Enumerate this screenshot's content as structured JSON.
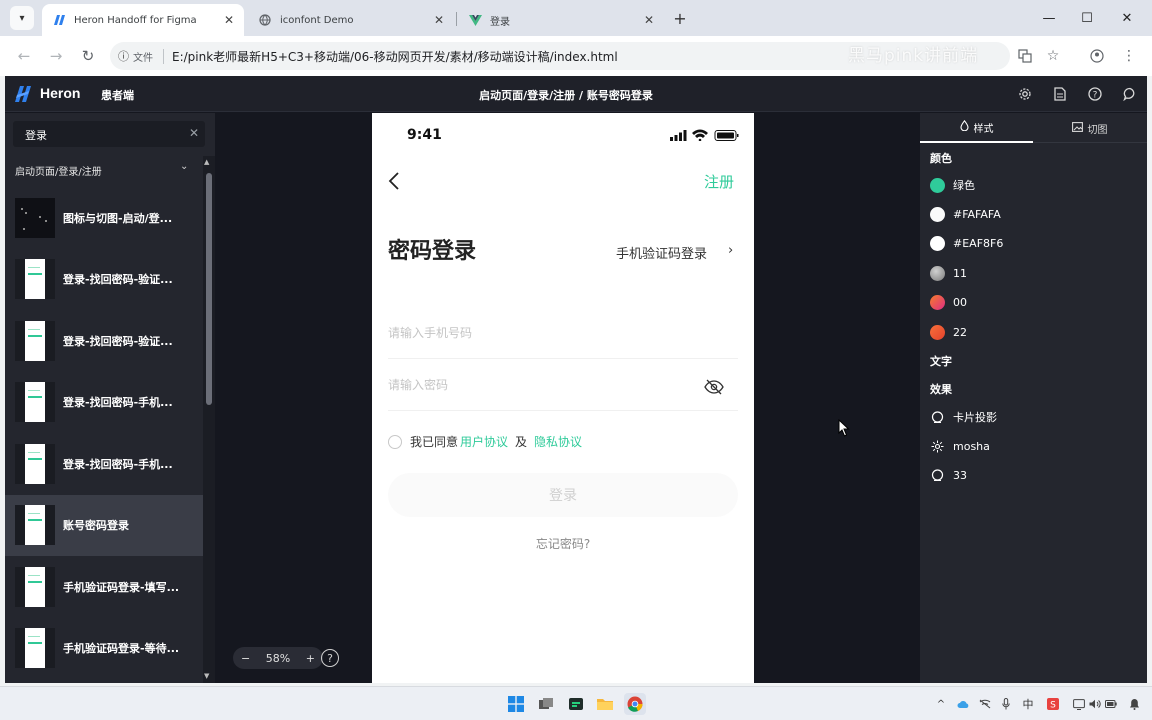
{
  "browser": {
    "tabs": [
      {
        "label": "Heron Handoff for Figma",
        "icon": "heron-tab-icon",
        "active": true
      },
      {
        "label": "iconfont Demo",
        "icon": "globe-icon",
        "active": false
      },
      {
        "label": "登录",
        "icon": "vue-logo-icon",
        "active": false
      }
    ],
    "address": {
      "scheme_label": "文件",
      "url": "E:/pink老师最新H5+C3+移动端/06-移动网页开发/素材/移动端设计稿/index.html"
    },
    "watermark": "黑马pink讲前端"
  },
  "header": {
    "logo": "Heron",
    "subtitle": "患者端",
    "breadcrumb_path": "启动页面/登录/注册",
    "breadcrumb_sep": " / ",
    "breadcrumb_current": "账号密码登录"
  },
  "sidebar": {
    "search_value": "登录",
    "group_label": "启动页面/登录/注册",
    "pages": [
      {
        "label": "图标与切图-启动/登...",
        "thumb": "dark"
      },
      {
        "label": "登录-找回密码-验证...",
        "thumb": "light"
      },
      {
        "label": "登录-找回密码-验证...",
        "thumb": "light"
      },
      {
        "label": "登录-找回密码-手机...",
        "thumb": "light"
      },
      {
        "label": "登录-找回密码-手机...",
        "thumb": "light"
      },
      {
        "label": "账号密码登录",
        "thumb": "light",
        "active": true
      },
      {
        "label": "手机验证码登录-填写...",
        "thumb": "light"
      },
      {
        "label": "手机验证码登录-等待...",
        "thumb": "light"
      }
    ]
  },
  "canvas": {
    "zoom": "58%",
    "zoom_minus": "−",
    "zoom_plus": "+",
    "help": "?"
  },
  "phone": {
    "time": "9:41",
    "register": "注册",
    "title": "密码登录",
    "sms_login": "手机验证码登录",
    "phone_placeholder": "请输入手机号码",
    "password_placeholder": "请输入密码",
    "agree_prefix": "我已同意",
    "user_agreement": "用户协议",
    "and": "及",
    "privacy": "隐私协议",
    "login_button": "登录",
    "forgot": "忘记密码?"
  },
  "right_panel": {
    "tabs": [
      "样式",
      "切图"
    ],
    "colors_title": "颜色",
    "colors": [
      {
        "name": "绿色",
        "color": "#2fcb9a"
      },
      {
        "name": "#FAFAFA",
        "color": "#fafafa"
      },
      {
        "name": "#EAF8F6",
        "color": "#eaf8f6"
      },
      {
        "name": "11",
        "color": "#9a9a9a"
      },
      {
        "name": "00",
        "color": "#e8446f"
      },
      {
        "name": "22",
        "color": "#f0542f"
      }
    ],
    "text_title": "文字",
    "effects_title": "效果",
    "effects": [
      {
        "name": "卡片投影",
        "icon": "shadow-icon"
      },
      {
        "name": "mosha",
        "icon": "blur-icon"
      },
      {
        "name": "33",
        "icon": "shadow-icon"
      }
    ]
  },
  "taskbar": {
    "ime": "中"
  }
}
